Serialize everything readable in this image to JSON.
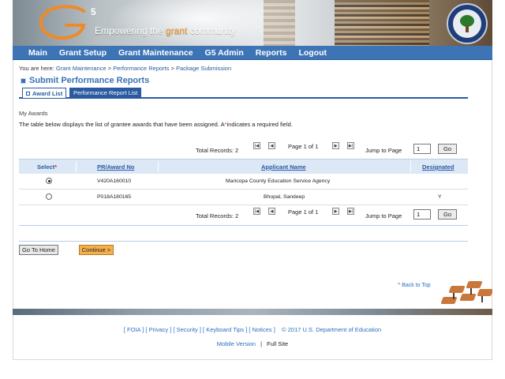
{
  "header": {
    "logo_text": "G",
    "logo_sup": "5",
    "tagline_before": "Empowering the",
    "tagline_grant": "grant",
    "tagline_after": "community"
  },
  "nav": {
    "items": [
      "Main",
      "Grant Setup",
      "Grant Maintenance",
      "G5 Admin",
      "Reports",
      "Logout"
    ]
  },
  "breadcrumb": {
    "prefix": "You are here:",
    "items": [
      "Grant Maintenance",
      "Performance Reports",
      "Package Submission"
    ],
    "separator": ">"
  },
  "page_title": "Submit Performance Reports",
  "tabs": {
    "active": "Award List",
    "inactive": "Performance Report List"
  },
  "section_label": "My Awards",
  "description": {
    "text": "The table below displays the list of grantee awards that have been assigned.  A",
    "req_mark": "*",
    "text_after": "indicates a required field."
  },
  "pager": {
    "total_label": "Total Records: 2",
    "page_info": "Page 1 of 1",
    "jump_label": "Jump to Page",
    "jump_value": "1",
    "go_label": "Go",
    "first_icon": "first-page-icon",
    "prev_icon": "prev-page-icon",
    "next_icon": "next-page-icon",
    "last_icon": "last-page-icon"
  },
  "table": {
    "headers": {
      "select": "Select",
      "select_req": "*",
      "pr_award": "PR/Award No",
      "applicant": "Applicant Name",
      "designated": "Designated"
    },
    "rows": [
      {
        "selected": true,
        "pr_award": "V420A160010",
        "applicant": "Maricopa County Education Service Agency",
        "designated": ""
      },
      {
        "selected": false,
        "pr_award": "P018A180165",
        "applicant": "Bhopal, Sandeep",
        "designated": "Y"
      }
    ]
  },
  "buttons": {
    "home": "Go To Home",
    "continue": "Continue >"
  },
  "back_to_top": "^ Back to Top",
  "footer": {
    "links": [
      "FOIA",
      "Privacy",
      "Security",
      "Keyboard Tips",
      "Notices"
    ],
    "copyright": "©  2017  U.S.  Department  of  Education",
    "mobile": "Mobile  Version",
    "divider": "|",
    "full": "Full  Site"
  },
  "colors": {
    "nav_blue": "#3d74b6",
    "title_blue": "#3a72b5",
    "link_blue": "#2a5aa0",
    "header_band": "#dce8f5",
    "continue_orange": "#f5b04a",
    "required_red": "#d03030"
  }
}
